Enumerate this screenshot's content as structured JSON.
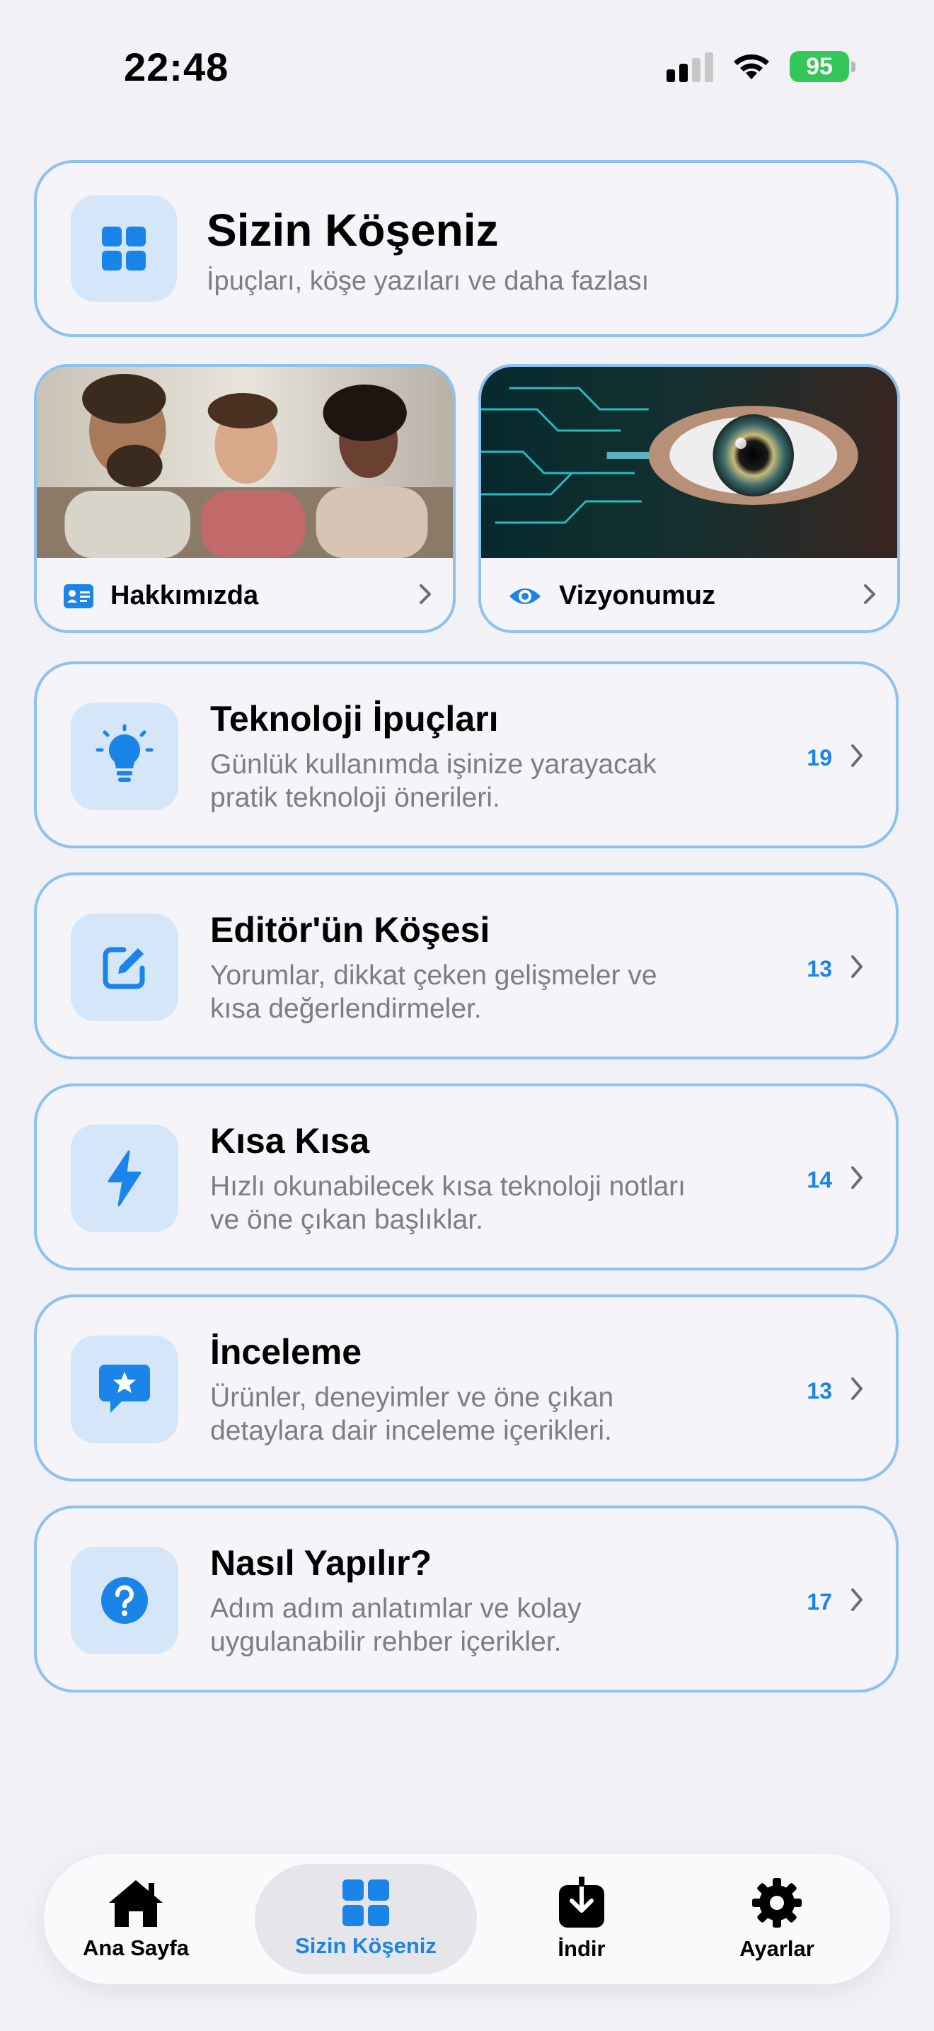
{
  "status": {
    "time": "22:48",
    "battery": "95"
  },
  "header": {
    "title": "Sizin Köşeniz",
    "subtitle": "İpuçları, köşe yazıları ve daha fazlası"
  },
  "feature_cards": [
    {
      "label": "Hakkımızda",
      "icon": "contact-card-icon"
    },
    {
      "label": "Vizyonumuz",
      "icon": "eye-icon"
    }
  ],
  "categories": [
    {
      "title": "Teknoloji İpuçları",
      "desc_line1": "Günlük kullanımda işinize yarayacak",
      "desc_line2": "pratik teknoloji önerileri.",
      "count": "19",
      "icon": "lightbulb-icon"
    },
    {
      "title": "Editör'ün Köşesi",
      "desc_line1": "Yorumlar, dikkat çeken gelişmeler ve",
      "desc_line2": "kısa değerlendirmeler.",
      "count": "13",
      "icon": "edit-icon"
    },
    {
      "title": "Kısa Kısa",
      "desc_line1": "Hızlı okunabilecek kısa teknoloji notları",
      "desc_line2": "ve öne çıkan başlıklar.",
      "count": "14",
      "icon": "bolt-icon"
    },
    {
      "title": "İnceleme",
      "desc_line1": "Ürünler, deneyimler ve öne çıkan",
      "desc_line2": "detaylara dair inceleme içerikleri.",
      "count": "13",
      "icon": "star-bubble-icon"
    },
    {
      "title": "Nasıl Yapılır?",
      "desc_line1": "Adım adım anlatımlar ve kolay",
      "desc_line2": "uygulanabilir rehber içerikler.",
      "count": "17",
      "icon": "question-icon"
    }
  ],
  "tabs": [
    {
      "label": "Ana Sayfa",
      "icon": "home-icon",
      "active": false
    },
    {
      "label": "Sizin Köşeniz",
      "icon": "grid-icon",
      "active": true
    },
    {
      "label": "İndir",
      "icon": "download-icon",
      "active": false
    },
    {
      "label": "Ayarlar",
      "icon": "gear-icon",
      "active": false
    }
  ],
  "colors": {
    "accent": "#1a84e8",
    "border": "#8cc1f0",
    "tile": "#d5e6f8",
    "background": "#f1f1f6"
  }
}
